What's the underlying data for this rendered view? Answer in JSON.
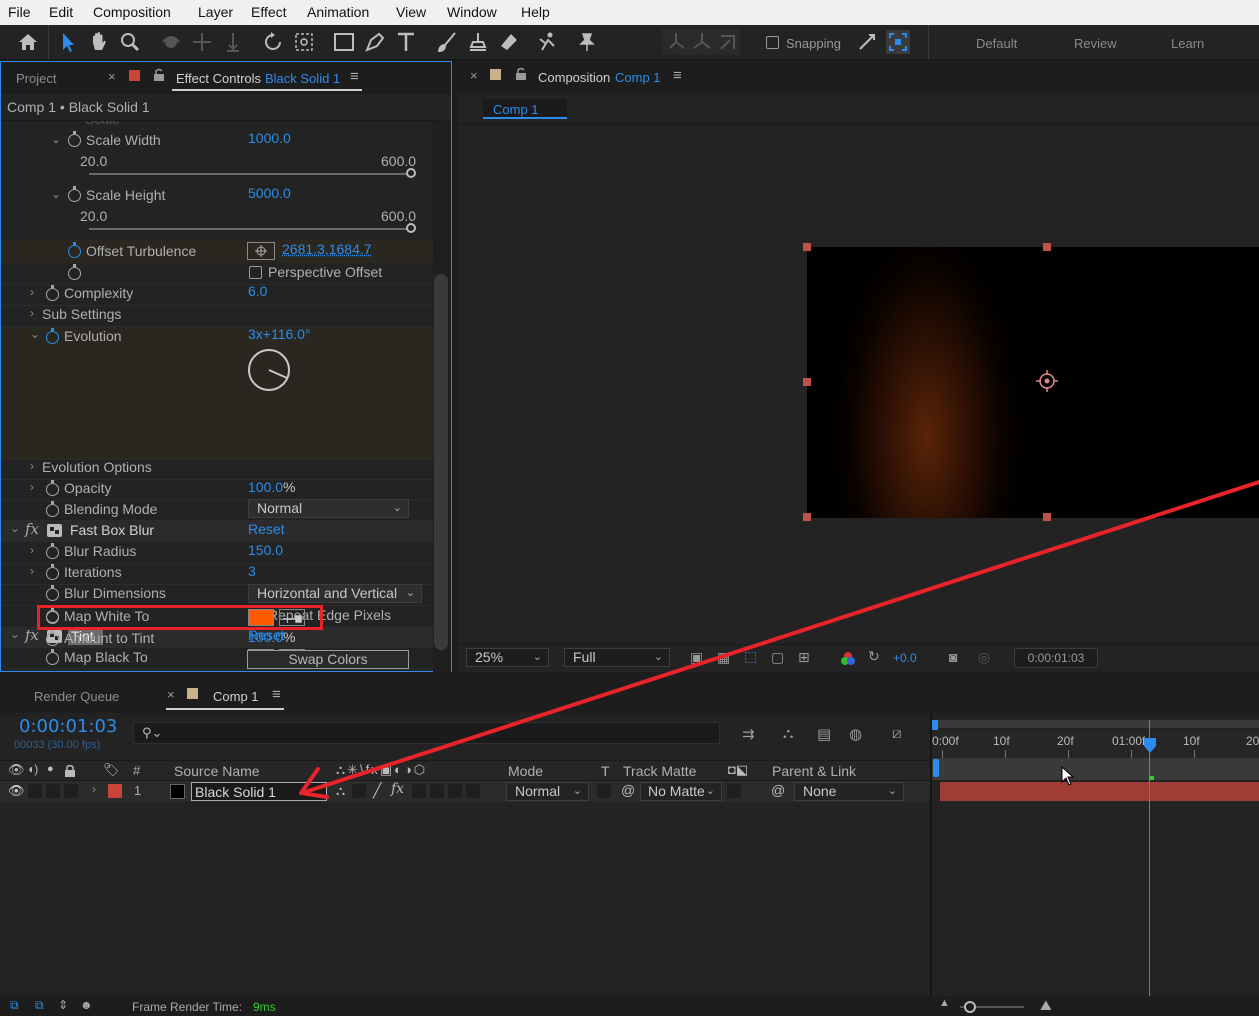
{
  "menu": [
    "File",
    "Edit",
    "Composition",
    "Layer",
    "Effect",
    "Animation",
    "View",
    "Window",
    "Help"
  ],
  "toolbar": {
    "snapping_label": "Snapping",
    "workspaces": [
      "Default",
      "Review",
      "Learn"
    ]
  },
  "effects_panel": {
    "project_tab": "Project",
    "effect_controls_tab_prefix": "Effect Controls",
    "effect_controls_tab_layer": "Black Solid 1",
    "breadcrumb": "Comp 1 • Black Solid 1",
    "props": {
      "scale_width": {
        "label": "Scale Width",
        "value": "1000.0",
        "min": "20.0",
        "max": "600.0"
      },
      "scale_height": {
        "label": "Scale Height",
        "value": "5000.0",
        "min": "20.0",
        "max": "600.0"
      },
      "offset_turbulence": {
        "label": "Offset Turbulence",
        "value": "2681.3,1684.7"
      },
      "perspective_offset": {
        "label": "Perspective Offset"
      },
      "complexity": {
        "label": "Complexity",
        "value": "6.0"
      },
      "sub_settings": {
        "label": "Sub Settings"
      },
      "evolution": {
        "label": "Evolution",
        "value": "3x+116.0°"
      },
      "evolution_options": {
        "label": "Evolution Options"
      },
      "opacity": {
        "label": "Opacity",
        "value": "100.0",
        "unit": "%"
      },
      "blending_mode": {
        "label": "Blending Mode",
        "value": "Normal"
      }
    },
    "fast_box_blur": {
      "name": "Fast Box Blur",
      "reset": "Reset",
      "blur_radius": {
        "label": "Blur Radius",
        "value": "150.0"
      },
      "iterations": {
        "label": "Iterations",
        "value": "3"
      },
      "blur_dimensions": {
        "label": "Blur Dimensions",
        "value": "Horizontal and Vertical"
      },
      "repeat_edge": {
        "label": "Repeat Edge Pixels",
        "checked": true
      }
    },
    "tint": {
      "name": "Tint",
      "reset": "Reset",
      "map_black": {
        "label": "Map Black To",
        "color": "#000000"
      },
      "map_white": {
        "label": "Map White To",
        "color": "#ff5a00"
      },
      "amount": {
        "label": "Amount to Tint",
        "value": "100.0",
        "unit": "%"
      },
      "swap_colors": "Swap Colors"
    }
  },
  "comp_panel": {
    "tab_prefix": "Composition",
    "tab_name": "Comp 1",
    "breadcrumb": "Comp 1",
    "zoom": "25%",
    "resolution": "Full",
    "exposure": "+0.0",
    "timecode": "0:00:01:03"
  },
  "timeline": {
    "render_queue_tab": "Render Queue",
    "comp_tab": "Comp 1",
    "timecode": "0:00:01:03",
    "frame_info": "00033 (30.00 fps)",
    "search_placeholder": "",
    "columns": {
      "num": "#",
      "source_name": "Source Name",
      "mode": "Mode",
      "t": "T",
      "track_matte": "Track Matte",
      "parent": "Parent & Link"
    },
    "ruler": [
      "0:00f",
      "10f",
      "20f",
      "01:00f",
      "10f",
      "20"
    ],
    "layer": {
      "index": "1",
      "name": "Black Solid 1",
      "mode": "Normal",
      "track_matte": "No Matte",
      "parent": "None",
      "label_color": "#c9453a"
    },
    "footer_label": "Frame Render Time:",
    "footer_value": "9ms"
  },
  "annotation_color": "#e8232a"
}
